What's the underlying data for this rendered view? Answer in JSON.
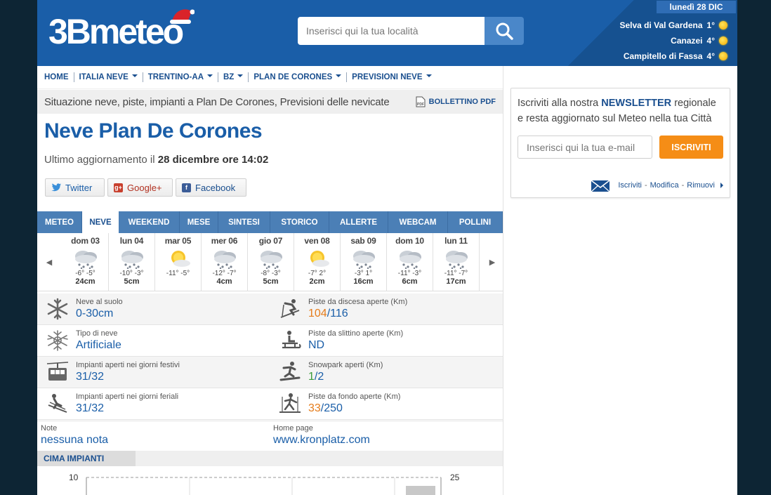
{
  "header": {
    "logo_text": "3Bmeteo",
    "search_placeholder": "Inserisci qui la tua località",
    "date": "lunedì 28 DIC",
    "cities": [
      {
        "name": "Selva di Val Gardena",
        "temp": "1°"
      },
      {
        "name": "Canazei",
        "temp": "4°"
      },
      {
        "name": "Campitello di Fassa",
        "temp": "4°"
      }
    ]
  },
  "breadcrumb": [
    {
      "label": "HOME",
      "dropdown": false
    },
    {
      "label": "ITALIA NEVE",
      "dropdown": true
    },
    {
      "label": "TRENTINO-AA",
      "dropdown": true
    },
    {
      "label": "BZ",
      "dropdown": true
    },
    {
      "label": "PLAN DE CORONES",
      "dropdown": true
    },
    {
      "label": "PREVISIONI NEVE",
      "dropdown": true
    }
  ],
  "subtitle": "Situazione neve, piste, impianti a Plan De Corones, Previsioni delle nevicate",
  "pdf_label": "BOLLETTINO PDF",
  "page_title": "Neve Plan De Corones",
  "update": {
    "prefix": "Ultimo aggiornamento il",
    "value": "28 dicembre ore 14:02"
  },
  "social": {
    "twitter": "Twitter",
    "google": "Google+",
    "facebook": "Facebook"
  },
  "tabs": [
    {
      "label": "METEO",
      "width": 64,
      "active": false
    },
    {
      "label": "NEVE",
      "width": 52,
      "active": true
    },
    {
      "label": "WEEKEND",
      "width": 87,
      "active": false
    },
    {
      "label": "MESE",
      "width": 55,
      "active": false
    },
    {
      "label": "SINTESI",
      "width": 74,
      "active": false
    },
    {
      "label": "STORICO",
      "width": 84,
      "active": false
    },
    {
      "label": "ALLERTE",
      "width": 84,
      "active": false
    },
    {
      "label": "WEBCAM",
      "width": 85,
      "active": false
    },
    {
      "label": "POLLINI",
      "width": 78,
      "active": false
    }
  ],
  "forecast": [
    {
      "day": "dom 03",
      "icon": "snow",
      "temp": "-6° -5°",
      "snow": "24cm"
    },
    {
      "day": "lun 04",
      "icon": "snow",
      "temp": "-10° -3°",
      "snow": "5cm"
    },
    {
      "day": "mar 05",
      "icon": "sun",
      "temp": "-11° -5°",
      "snow": ""
    },
    {
      "day": "mer 06",
      "icon": "snow",
      "temp": "-12° -7°",
      "snow": "4cm"
    },
    {
      "day": "gio 07",
      "icon": "snow",
      "temp": "-8° -3°",
      "snow": "5cm"
    },
    {
      "day": "ven 08",
      "icon": "sun",
      "temp": "-7° 2°",
      "snow": "2cm"
    },
    {
      "day": "sab 09",
      "icon": "snow",
      "temp": "-3° 1°",
      "snow": "16cm"
    },
    {
      "day": "dom 10",
      "icon": "snow",
      "temp": "-11° -3°",
      "snow": "6cm"
    },
    {
      "day": "lun 11",
      "icon": "snow",
      "temp": "-11° -7°",
      "snow": "17cm"
    }
  ],
  "stats": {
    "neve_suolo": {
      "label": "Neve al suolo",
      "value": "0-30cm"
    },
    "piste_discesa": {
      "label": "Piste da discesa aperte (Km)",
      "open": "104",
      "total": "/116"
    },
    "tipo_neve": {
      "label": "Tipo di neve",
      "value": "Artificiale"
    },
    "piste_slittino": {
      "label": "Piste da slittino aperte (Km)",
      "value": "ND"
    },
    "impianti_festivi": {
      "label": "Impianti aperti nei giorni festivi",
      "value": "31/32"
    },
    "snowpark": {
      "label": "Snowpark aperti (Km)",
      "open": "1",
      "total": "/2"
    },
    "impianti_feriali": {
      "label": "Impianti aperti nei giorni feriali",
      "value": "31/32"
    },
    "piste_fondo": {
      "label": "Piste da fondo aperte (Km)",
      "open": "33",
      "total": "/250"
    }
  },
  "notes": {
    "label": "Note",
    "value": "nessuna nota"
  },
  "homepage": {
    "label": "Home page",
    "value": "www.kronplatz.com"
  },
  "cima": {
    "label": "CIMA IMPIANTI",
    "axis_left_top": "10",
    "axis_right_top": "25"
  },
  "newsletter": {
    "text_before": "Iscriviti alla nostra",
    "highlight": "NEWSLETTER",
    "text_after": "regionale e resta aggiornato sul Meteo nella tua Città",
    "input_placeholder": "Inserisci qui la tua e-mail",
    "button": "ISCRIVITI",
    "links": [
      "Iscriviti",
      "Modifica",
      "Rimuovi"
    ]
  },
  "colors": {
    "header": "#1a5ea8",
    "tabs": "#4b7fb6",
    "accent_orange": "#f58d16",
    "link_blue": "#1a4f8f"
  }
}
